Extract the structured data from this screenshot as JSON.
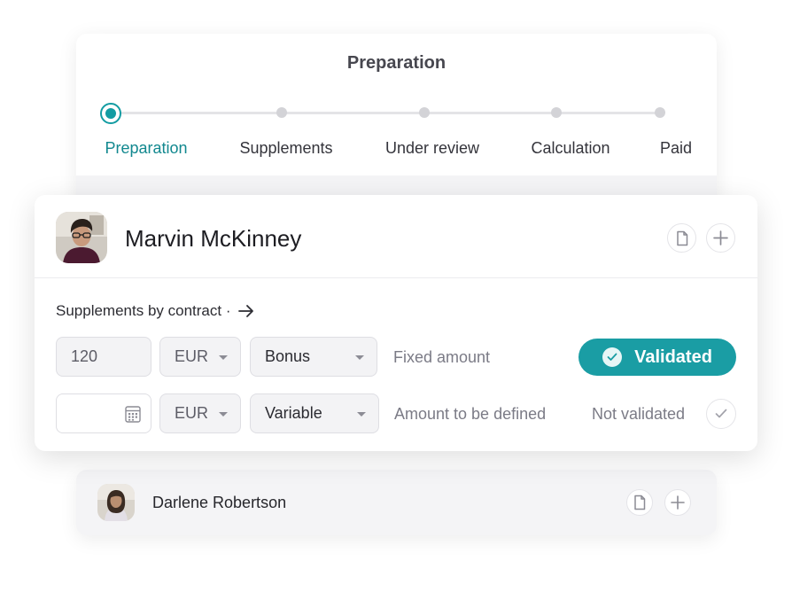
{
  "stepper": {
    "title": "Preparation",
    "steps": [
      {
        "label": "Preparation",
        "active": true
      },
      {
        "label": "Supplements",
        "active": false
      },
      {
        "label": "Under review",
        "active": false
      },
      {
        "label": "Calculation",
        "active": false
      },
      {
        "label": "Paid",
        "active": false
      }
    ]
  },
  "employee": {
    "name": "Marvin McKinney",
    "section_label": "Supplements by contract ·",
    "rows": [
      {
        "amount_value": "120",
        "amount_placeholder": "",
        "currency": "EUR",
        "type": "Bonus",
        "description": "Fixed amount",
        "status": "Validated"
      },
      {
        "amount_value": "",
        "amount_placeholder": "",
        "currency": "EUR",
        "type": "Variable",
        "description": "Amount to be defined",
        "status": "Not validated"
      }
    ]
  },
  "next_employee": {
    "name": "Darlene Robertson"
  },
  "colors": {
    "accent": "#1a9da4",
    "accent_text": "#12888f"
  },
  "icons": [
    "document-icon",
    "plus-icon",
    "arrow-right-icon",
    "calendar-icon",
    "check-icon",
    "chevron-down-icon"
  ]
}
